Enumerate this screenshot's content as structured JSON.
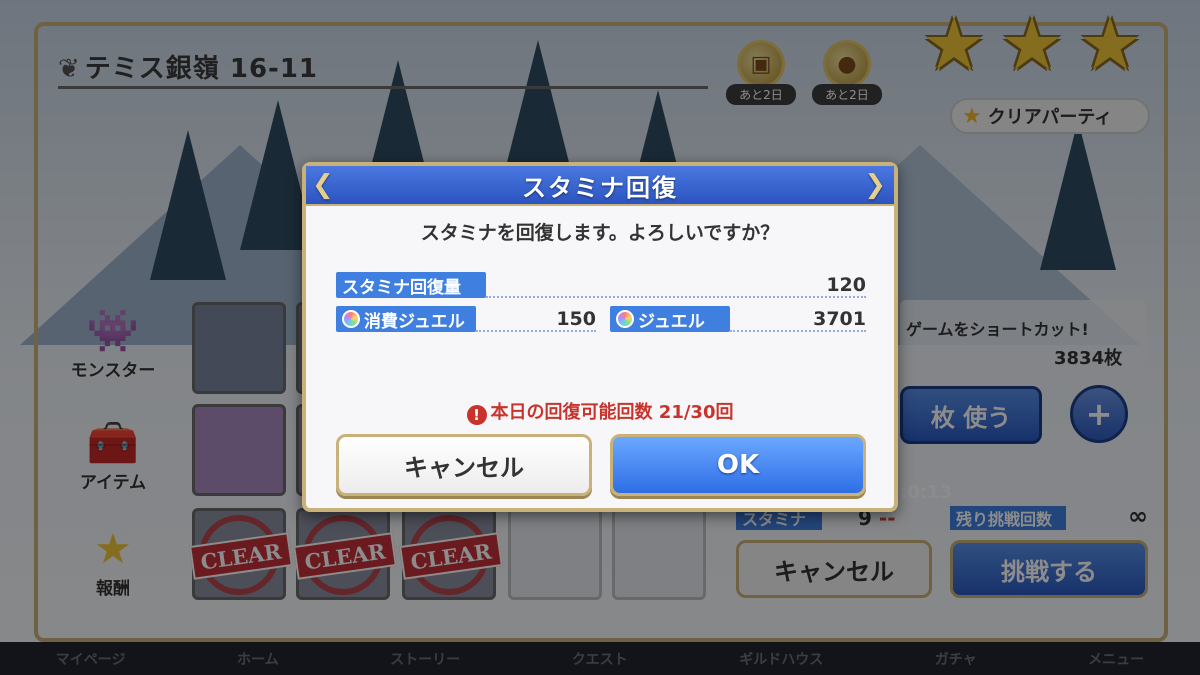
{
  "stage": {
    "title": "テミス銀嶺 16-11"
  },
  "buffs": [
    {
      "icon": "treasure-chest-plus-icon",
      "days": "あと2日"
    },
    {
      "icon": "orb-up-icon",
      "days": "あと2日"
    }
  ],
  "clear_party": {
    "label": "クリアパーティ"
  },
  "side_menu": [
    {
      "key": "monster",
      "label": "モンスター",
      "icon": "monster-icon"
    },
    {
      "key": "item",
      "label": "アイテム",
      "icon": "treasure-chest-icon"
    },
    {
      "key": "reward",
      "label": "報酬",
      "icon": "star-icon"
    }
  ],
  "slots": {
    "clear_label": "CLEAR"
  },
  "right_panel": {
    "shortcut_text": "ゲームをショートカット!",
    "tickets": "3834枚",
    "use_button": "枚 使う",
    "plus": "+",
    "timer": ":0:13",
    "stamina_label": "スタミナ",
    "stamina_value": "9",
    "stamina_delta": "--",
    "remaining_label": "残り挑戦回数",
    "remaining_value": "∞",
    "cancel_button": "キャンセル",
    "challenge_button": "挑戦する"
  },
  "bottom_nav": [
    "マイページ",
    "ホーム",
    "ストーリー",
    "クエスト",
    "ギルドハウス",
    "ガチャ",
    "メニュー"
  ],
  "modal": {
    "title": "スタミナ回復",
    "message": "スタミナを回復します。よろしいですか？",
    "recover_label": "スタミナ回復量",
    "recover_value": "120",
    "cost_label": "消費ジュエル",
    "cost_value": "150",
    "jewel_label": "ジュエル",
    "jewel_value": "3701",
    "warning": "本日の回復可能回数 21/30回",
    "cancel_label": "キャンセル",
    "ok_label": "OK"
  },
  "colors": {
    "accent_blue": "#3f7fe0",
    "frame_gold": "#c9b27a",
    "warning_red": "#c8342c",
    "star_gold": "#f2c63a"
  }
}
